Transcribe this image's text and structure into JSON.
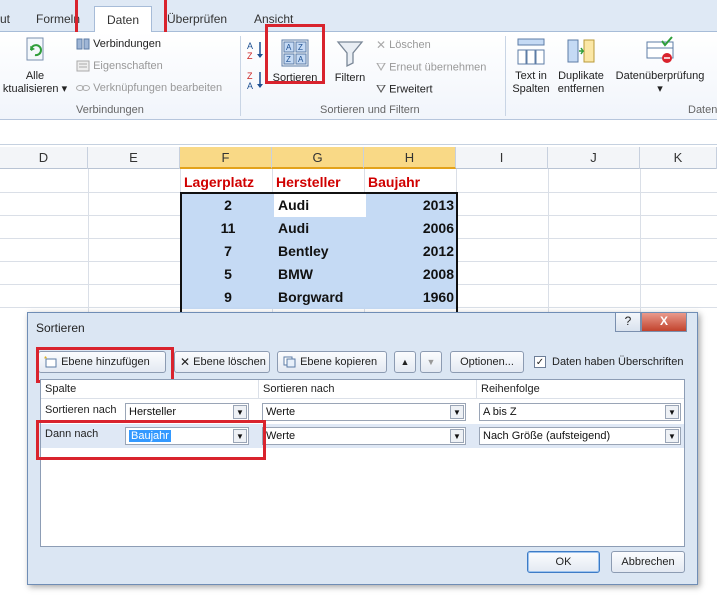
{
  "ribbon": {
    "tabs": [
      "ut",
      "Formeln",
      "Daten",
      "Überprüfen",
      "Ansicht"
    ],
    "connections": {
      "refresh_all": [
        "Alle",
        "ktualisieren"
      ],
      "items": [
        "Verbindungen",
        "Eigenschaften",
        "Verknüpfungen bearbeiten"
      ],
      "group": "Verbindungen"
    },
    "sort_filter": {
      "sort": "Sortieren",
      "filter": "Filtern",
      "clear": "Löschen",
      "reapply": "Erneut übernehmen",
      "advanced": "Erweitert",
      "group": "Sortieren und Filtern"
    },
    "tools": {
      "text_to_columns": [
        "Text in",
        "Spalten"
      ],
      "remove_duplicates": [
        "Duplikate",
        "entfernen"
      ],
      "data_validation": "Datenüberprüfung",
      "group": "Daten"
    }
  },
  "sheet": {
    "columns": [
      "D",
      "E",
      "F",
      "G",
      "H",
      "I",
      "J",
      "K"
    ],
    "headers": [
      "Lagerplatz",
      "Hersteller",
      "Baujahr"
    ],
    "rows": [
      {
        "lagerplatz": "2",
        "hersteller": "Audi",
        "baujahr": "2013"
      },
      {
        "lagerplatz": "11",
        "hersteller": "Audi",
        "baujahr": "2006"
      },
      {
        "lagerplatz": "7",
        "hersteller": "Bentley",
        "baujahr": "2012"
      },
      {
        "lagerplatz": "5",
        "hersteller": "BMW",
        "baujahr": "2008"
      },
      {
        "lagerplatz": "9",
        "hersteller": "Borgward",
        "baujahr": "1960"
      }
    ]
  },
  "dialog": {
    "title": "Sortieren",
    "help": "?",
    "close": "X",
    "buttons": {
      "add_level": "Ebene hinzufügen",
      "delete_level": "Ebene löschen",
      "copy_level": "Ebene kopieren",
      "options": "Optionen...",
      "ok": "OK",
      "cancel": "Abbrechen"
    },
    "has_headers_label": "Daten haben Überschriften",
    "has_headers_checked": true,
    "columns": [
      "Spalte",
      "Sortieren nach",
      "Reihenfolge"
    ],
    "levels": [
      {
        "label": "Sortieren nach",
        "column": "Hersteller",
        "sort_on": "Werte",
        "order": "A bis Z"
      },
      {
        "label": "Dann nach",
        "column": "Baujahr",
        "sort_on": "Werte",
        "order": "Nach Größe (aufsteigend)"
      }
    ]
  },
  "colors": {
    "highlight_red": "#d9232d",
    "header_text_red": "#d00000",
    "cell_blue": "#c5daf4",
    "selected_col": "#f9d986"
  }
}
